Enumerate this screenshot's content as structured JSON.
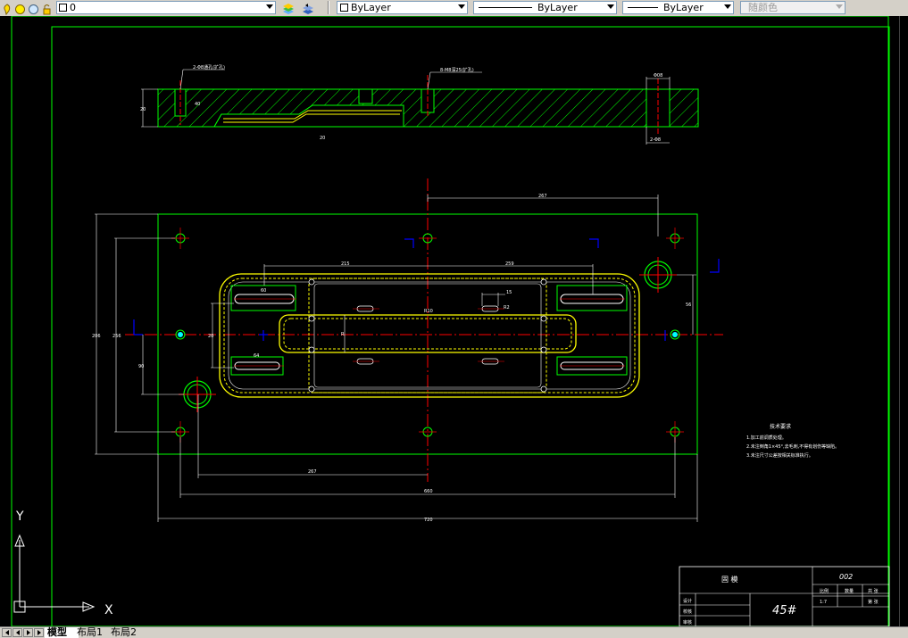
{
  "toolbar": {
    "layer": {
      "name": "0"
    },
    "color": {
      "value": "ByLayer"
    },
    "linetype": {
      "value": "ByLayer"
    },
    "lineweight": {
      "value": "ByLayer"
    },
    "plotstyle": {
      "value": "随颜色"
    }
  },
  "drawing": {
    "section_notes": {
      "a": "2-Φ8通孔(扩孔)",
      "b": "8-M8深25(扩孔)",
      "c": "Φ08"
    },
    "section_dims": {
      "h": "20",
      "h2": "40",
      "d1": "20",
      "d2": "2-Φ8"
    },
    "dims": {
      "top_267": "267",
      "d_215": "215",
      "d_259": "259",
      "d_15": "15",
      "d_r2": "R2",
      "d_r10": "R10",
      "d_60": "60",
      "d_64": "64",
      "d_20": "20",
      "d_r": "R",
      "d_56": "56",
      "d_206": "206",
      "d_256": "256",
      "d_90": "90",
      "bot_267": "267",
      "bot_660": "660",
      "bot_720": "720"
    },
    "tech_notes": {
      "title": "技术要求",
      "lines": [
        "1.加工前调质处理。",
        "2.未注倒角1×45°,去毛刺,不得有划伤等缺陷。",
        "3.未注尺寸公差按相关标准执行。"
      ]
    },
    "title_block": {
      "part_name": "固  模",
      "drawing_no": "002",
      "material": "45#",
      "scale_label": "比例",
      "count_label": "数量",
      "sheet_a": "共 张",
      "scale_value": "1:7",
      "sheet_b": "第 张",
      "designer": "设计",
      "checker": "校核",
      "approver": "审核"
    },
    "ucs": {
      "x": "X",
      "y": "Y"
    }
  },
  "tabs": {
    "model": "模型",
    "layout1": "布局1",
    "layout2": "布局2"
  },
  "colors": {
    "green": "#00ff00",
    "yellow": "#ffff00",
    "red": "#ff0000",
    "white": "#ffffff",
    "blue": "#0000ff"
  }
}
